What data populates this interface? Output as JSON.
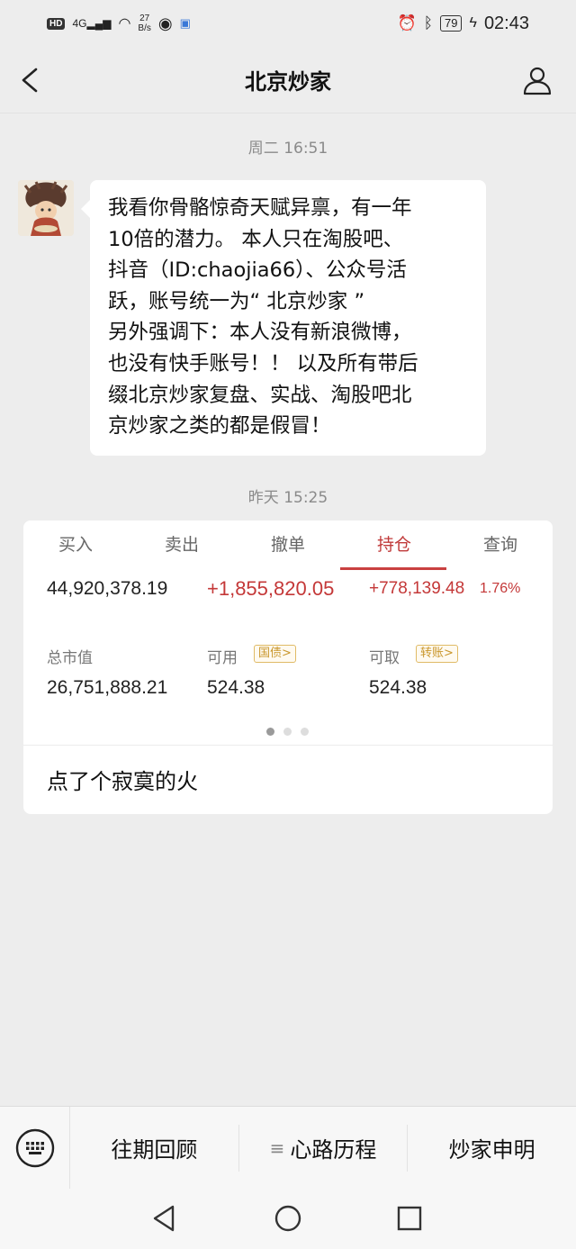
{
  "status_bar": {
    "hd": "HD",
    "network": "4G",
    "speed_value": "27",
    "speed_unit": "B/s",
    "battery": "79",
    "time": "02:43"
  },
  "header": {
    "title": "北京炒家"
  },
  "chat": {
    "timestamp_1": "周二 16:51",
    "message_lines": [
      "我看你骨骼惊奇天赋异禀，有一年",
      "10倍的潜力。 本人只在淘股吧、",
      "抖音（ID:chaojia66）、公众号活",
      "跃，账号统一为“ 北京炒家 ”",
      "另外强调下：本人没有新浪微博，",
      "也没有快手账号！！ 以及所有带后",
      "缀北京炒家复盘、实战、淘股吧北",
      "京炒家之类的都是假冒！"
    ],
    "timestamp_2": "昨天 15:25"
  },
  "card": {
    "tabs": [
      "买入",
      "卖出",
      "撤单",
      "持仓",
      "查询"
    ],
    "active_tab": "持仓",
    "row1": {
      "total_assets": "44,920,378.19",
      "total_profit": "+1,855,820.05",
      "day_profit": "+778,139.48",
      "day_pct": "1.76%"
    },
    "row2": {
      "market_value_label": "总市值",
      "market_value": "26,751,888.21",
      "available_label": "可用",
      "available_button": "国债>",
      "available_value": "524.38",
      "withdrawable_label": "可取",
      "withdrawable_button": "转账>",
      "withdrawable_value": "524.38"
    },
    "page_dots": 3,
    "active_dot": 0,
    "caption": "点了个寂寞的火"
  },
  "bottom_menu": {
    "items": [
      "往期回顾",
      "心路历程",
      "炒家申明"
    ]
  },
  "colors": {
    "accent_red": "#c43838",
    "background": "#ededed",
    "gold": "#c9962b"
  }
}
